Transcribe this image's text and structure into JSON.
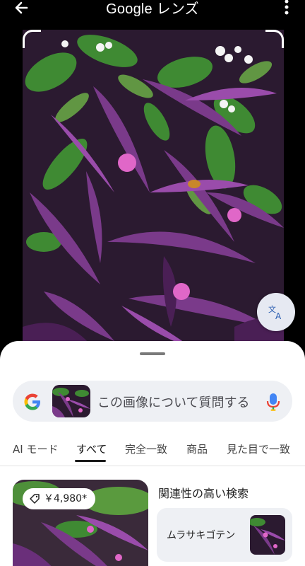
{
  "app": {
    "title": "Google レンズ"
  },
  "search": {
    "placeholder": "この画像について質問する"
  },
  "tabs": [
    {
      "label": "AI モード"
    },
    {
      "label": "すべて"
    },
    {
      "label": "完全一致"
    },
    {
      "label": "商品"
    },
    {
      "label": "見た目で一致"
    }
  ],
  "active_tab": "すべて",
  "results": {
    "price": "￥4,980*",
    "related_title": "関連性の高い検索",
    "related_items": [
      {
        "label": "ムラサキゴテン"
      }
    ]
  },
  "colors": {
    "google_blue": "#4285F4",
    "google_red": "#EA4335",
    "google_yellow": "#FBBC05",
    "google_green": "#34A853",
    "plant_purple": "#6a2f7a"
  },
  "icons": [
    "back-arrow-icon",
    "more-vert-icon",
    "translate-icon",
    "google-g-icon",
    "mic-icon",
    "price-tag-icon"
  ]
}
